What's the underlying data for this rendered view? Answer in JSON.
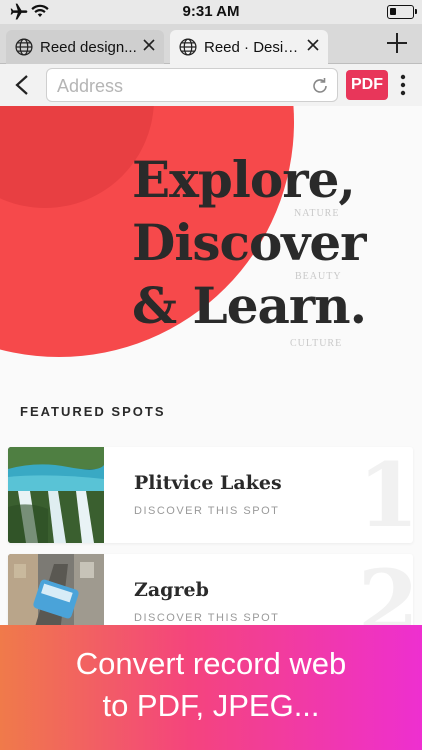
{
  "status_bar": {
    "time": "9:31 AM",
    "icons": [
      "airplane-icon",
      "wifi-icon",
      "battery-icon"
    ]
  },
  "tabs": [
    {
      "title": "Reed design...",
      "icon": "globe-icon",
      "active": false
    },
    {
      "title": "Reed · Desig...",
      "icon": "globe-icon",
      "active": true
    }
  ],
  "toolbar": {
    "address_placeholder": "Address",
    "address_value": "",
    "pdf_label": "PDF"
  },
  "hero": {
    "line1": "Explore,",
    "line2": "Discover",
    "line3": "& Learn.",
    "tags": [
      "NATURE",
      "BEAUTY",
      "CULTURE"
    ]
  },
  "featured": {
    "heading": "FEATURED SPOTS",
    "spots": [
      {
        "name": "Plitvice Lakes",
        "action": "DISCOVER THIS SPOT",
        "number": "1"
      },
      {
        "name": "Zagreb",
        "action": "DISCOVER THIS SPOT",
        "number": "2"
      }
    ]
  },
  "banner": {
    "line1": "Convert record web",
    "line2": "to PDF, JPEG..."
  },
  "colors": {
    "accent_red": "#f6494b",
    "pdf_button": "#e8365a",
    "banner_gradient_start": "#f07a4a",
    "banner_gradient_end": "#ee2fd0"
  }
}
